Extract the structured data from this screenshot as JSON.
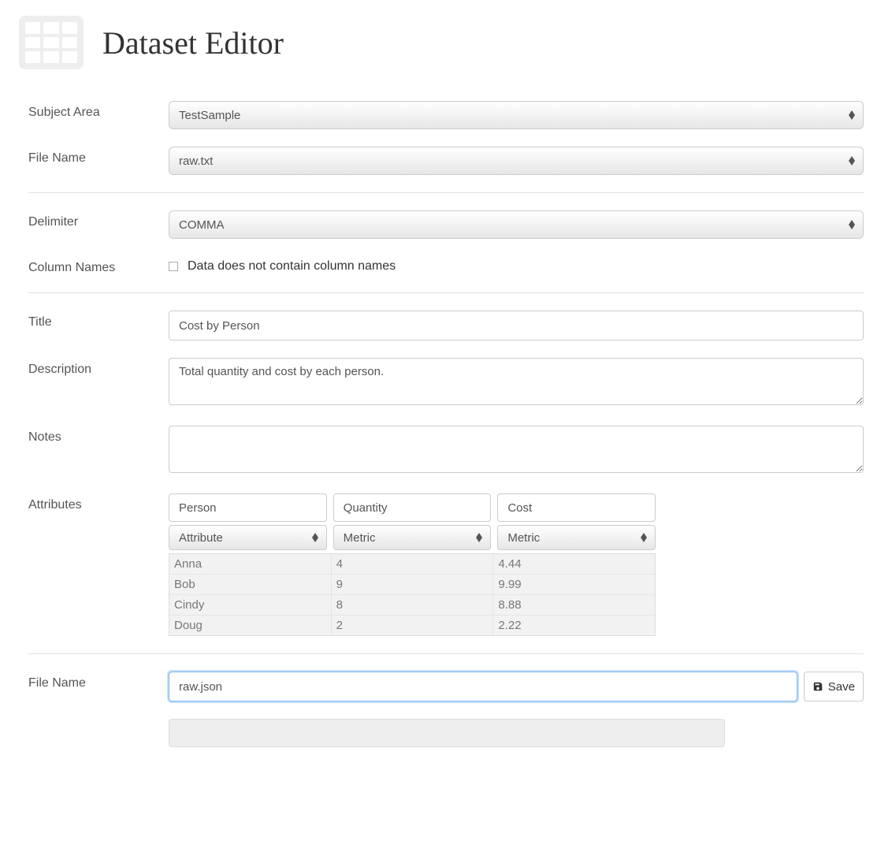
{
  "header": {
    "title": "Dataset Editor"
  },
  "labels": {
    "subject_area": "Subject Area",
    "file_name_top": "File Name",
    "delimiter": "Delimiter",
    "column_names": "Column Names",
    "col_checkbox": "Data does not contain column names",
    "title": "Title",
    "description": "Description",
    "notes": "Notes",
    "attributes": "Attributes",
    "file_name_bottom": "File Name",
    "save": "Save"
  },
  "values": {
    "subject_area": "TestSample",
    "file_name_top": "raw.txt",
    "delimiter": "COMMA",
    "title": "Cost by Person",
    "description": "Total quantity and cost by each person.",
    "notes": "",
    "file_name_bottom": "raw.json"
  },
  "attributes": {
    "names": [
      "Person",
      "Quantity",
      "Cost"
    ],
    "types": [
      "Attribute",
      "Metric",
      "Metric"
    ],
    "rows": [
      [
        "Anna",
        "4",
        "4.44"
      ],
      [
        "Bob",
        "9",
        "9.99"
      ],
      [
        "Cindy",
        "8",
        "8.88"
      ],
      [
        "Doug",
        "2",
        "2.22"
      ]
    ]
  }
}
